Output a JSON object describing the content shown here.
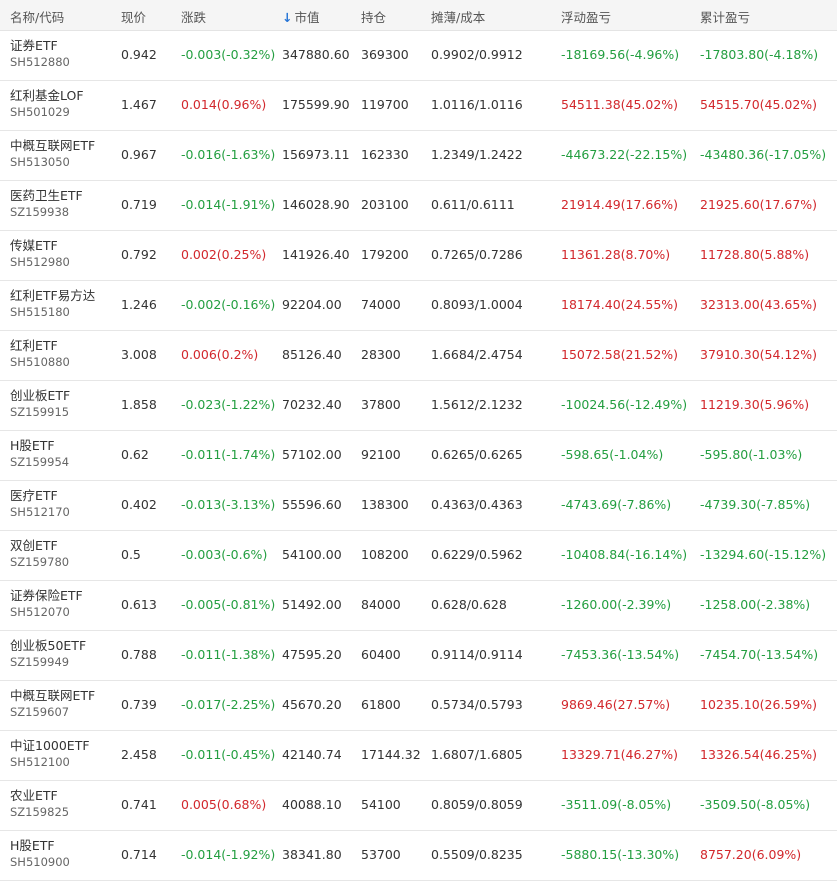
{
  "colors": {
    "up": "#d2272c",
    "down": "#239e40",
    "sort": "#2775d6"
  },
  "header": {
    "name": "名称/代码",
    "price": "现价",
    "change": "涨跌",
    "sort_icon": "↓",
    "market_value": "市值",
    "holding": "持仓",
    "cost": "摊薄/成本",
    "float_pl": "浮动盈亏",
    "total_pl": "累计盈亏"
  },
  "rows": [
    {
      "name": "证券ETF",
      "code": "SH512880",
      "price": "0.942",
      "change": "-0.003(-0.32%)",
      "change_dir": "neg",
      "mv": "347880.60",
      "hold": "369300",
      "cost": "0.9902/0.9912",
      "fpl": "-18169.56(-4.96%)",
      "fpl_dir": "neg",
      "tpl": "-17803.80(-4.18%)",
      "tpl_dir": "neg"
    },
    {
      "name": "红利基金LOF",
      "code": "SH501029",
      "price": "1.467",
      "change": "0.014(0.96%)",
      "change_dir": "pos",
      "mv": "175599.90",
      "hold": "119700",
      "cost": "1.0116/1.0116",
      "fpl": "54511.38(45.02%)",
      "fpl_dir": "pos",
      "tpl": "54515.70(45.02%)",
      "tpl_dir": "pos"
    },
    {
      "name": "中概互联网ETF",
      "code": "SH513050",
      "price": "0.967",
      "change": "-0.016(-1.63%)",
      "change_dir": "neg",
      "mv": "156973.11",
      "hold": "162330",
      "cost": "1.2349/1.2422",
      "fpl": "-44673.22(-22.15%)",
      "fpl_dir": "neg",
      "tpl": "-43480.36(-17.05%)",
      "tpl_dir": "neg"
    },
    {
      "name": "医药卫生ETF",
      "code": "SZ159938",
      "price": "0.719",
      "change": "-0.014(-1.91%)",
      "change_dir": "neg",
      "mv": "146028.90",
      "hold": "203100",
      "cost": "0.611/0.6111",
      "fpl": "21914.49(17.66%)",
      "fpl_dir": "pos",
      "tpl": "21925.60(17.67%)",
      "tpl_dir": "pos"
    },
    {
      "name": "传媒ETF",
      "code": "SH512980",
      "price": "0.792",
      "change": "0.002(0.25%)",
      "change_dir": "pos",
      "mv": "141926.40",
      "hold": "179200",
      "cost": "0.7265/0.7286",
      "fpl": "11361.28(8.70%)",
      "fpl_dir": "pos",
      "tpl": "11728.80(5.88%)",
      "tpl_dir": "pos"
    },
    {
      "name": "红利ETF易方达",
      "code": "SH515180",
      "price": "1.246",
      "change": "-0.002(-0.16%)",
      "change_dir": "neg",
      "mv": "92204.00",
      "hold": "74000",
      "cost": "0.8093/1.0004",
      "fpl": "18174.40(24.55%)",
      "fpl_dir": "pos",
      "tpl": "32313.00(43.65%)",
      "tpl_dir": "pos"
    },
    {
      "name": "红利ETF",
      "code": "SH510880",
      "price": "3.008",
      "change": "0.006(0.2%)",
      "change_dir": "pos",
      "mv": "85126.40",
      "hold": "28300",
      "cost": "1.6684/2.4754",
      "fpl": "15072.58(21.52%)",
      "fpl_dir": "pos",
      "tpl": "37910.30(54.12%)",
      "tpl_dir": "pos"
    },
    {
      "name": "创业板ETF",
      "code": "SZ159915",
      "price": "1.858",
      "change": "-0.023(-1.22%)",
      "change_dir": "neg",
      "mv": "70232.40",
      "hold": "37800",
      "cost": "1.5612/2.1232",
      "fpl": "-10024.56(-12.49%)",
      "fpl_dir": "neg",
      "tpl": "11219.30(5.96%)",
      "tpl_dir": "pos"
    },
    {
      "name": "H股ETF",
      "code": "SZ159954",
      "price": "0.62",
      "change": "-0.011(-1.74%)",
      "change_dir": "neg",
      "mv": "57102.00",
      "hold": "92100",
      "cost": "0.6265/0.6265",
      "fpl": "-598.65(-1.04%)",
      "fpl_dir": "neg",
      "tpl": "-595.80(-1.03%)",
      "tpl_dir": "neg"
    },
    {
      "name": "医疗ETF",
      "code": "SH512170",
      "price": "0.402",
      "change": "-0.013(-3.13%)",
      "change_dir": "neg",
      "mv": "55596.60",
      "hold": "138300",
      "cost": "0.4363/0.4363",
      "fpl": "-4743.69(-7.86%)",
      "fpl_dir": "neg",
      "tpl": "-4739.30(-7.85%)",
      "tpl_dir": "neg"
    },
    {
      "name": "双创ETF",
      "code": "SZ159780",
      "price": "0.5",
      "change": "-0.003(-0.6%)",
      "change_dir": "neg",
      "mv": "54100.00",
      "hold": "108200",
      "cost": "0.6229/0.5962",
      "fpl": "-10408.84(-16.14%)",
      "fpl_dir": "neg",
      "tpl": "-13294.60(-15.12%)",
      "tpl_dir": "neg"
    },
    {
      "name": "证券保险ETF",
      "code": "SH512070",
      "price": "0.613",
      "change": "-0.005(-0.81%)",
      "change_dir": "neg",
      "mv": "51492.00",
      "hold": "84000",
      "cost": "0.628/0.628",
      "fpl": "-1260.00(-2.39%)",
      "fpl_dir": "neg",
      "tpl": "-1258.00(-2.38%)",
      "tpl_dir": "neg"
    },
    {
      "name": "创业板50ETF",
      "code": "SZ159949",
      "price": "0.788",
      "change": "-0.011(-1.38%)",
      "change_dir": "neg",
      "mv": "47595.20",
      "hold": "60400",
      "cost": "0.9114/0.9114",
      "fpl": "-7453.36(-13.54%)",
      "fpl_dir": "neg",
      "tpl": "-7454.70(-13.54%)",
      "tpl_dir": "neg"
    },
    {
      "name": "中概互联网ETF",
      "code": "SZ159607",
      "price": "0.739",
      "change": "-0.017(-2.25%)",
      "change_dir": "neg",
      "mv": "45670.20",
      "hold": "61800",
      "cost": "0.5734/0.5793",
      "fpl": "9869.46(27.57%)",
      "fpl_dir": "pos",
      "tpl": "10235.10(26.59%)",
      "tpl_dir": "pos"
    },
    {
      "name": "中证1000ETF",
      "code": "SH512100",
      "price": "2.458",
      "change": "-0.011(-0.45%)",
      "change_dir": "neg",
      "mv": "42140.74",
      "hold": "17144.32",
      "cost": "1.6807/1.6805",
      "fpl": "13329.71(46.27%)",
      "fpl_dir": "pos",
      "tpl": "13326.54(46.25%)",
      "tpl_dir": "pos"
    },
    {
      "name": "农业ETF",
      "code": "SZ159825",
      "price": "0.741",
      "change": "0.005(0.68%)",
      "change_dir": "pos",
      "mv": "40088.10",
      "hold": "54100",
      "cost": "0.8059/0.8059",
      "fpl": "-3511.09(-8.05%)",
      "fpl_dir": "neg",
      "tpl": "-3509.50(-8.05%)",
      "tpl_dir": "neg"
    },
    {
      "name": "H股ETF",
      "code": "SH510900",
      "price": "0.714",
      "change": "-0.014(-1.92%)",
      "change_dir": "neg",
      "mv": "38341.80",
      "hold": "53700",
      "cost": "0.5509/0.8235",
      "fpl": "-5880.15(-13.30%)",
      "fpl_dir": "neg",
      "tpl": "8757.20(6.09%)",
      "tpl_dir": "pos"
    }
  ]
}
